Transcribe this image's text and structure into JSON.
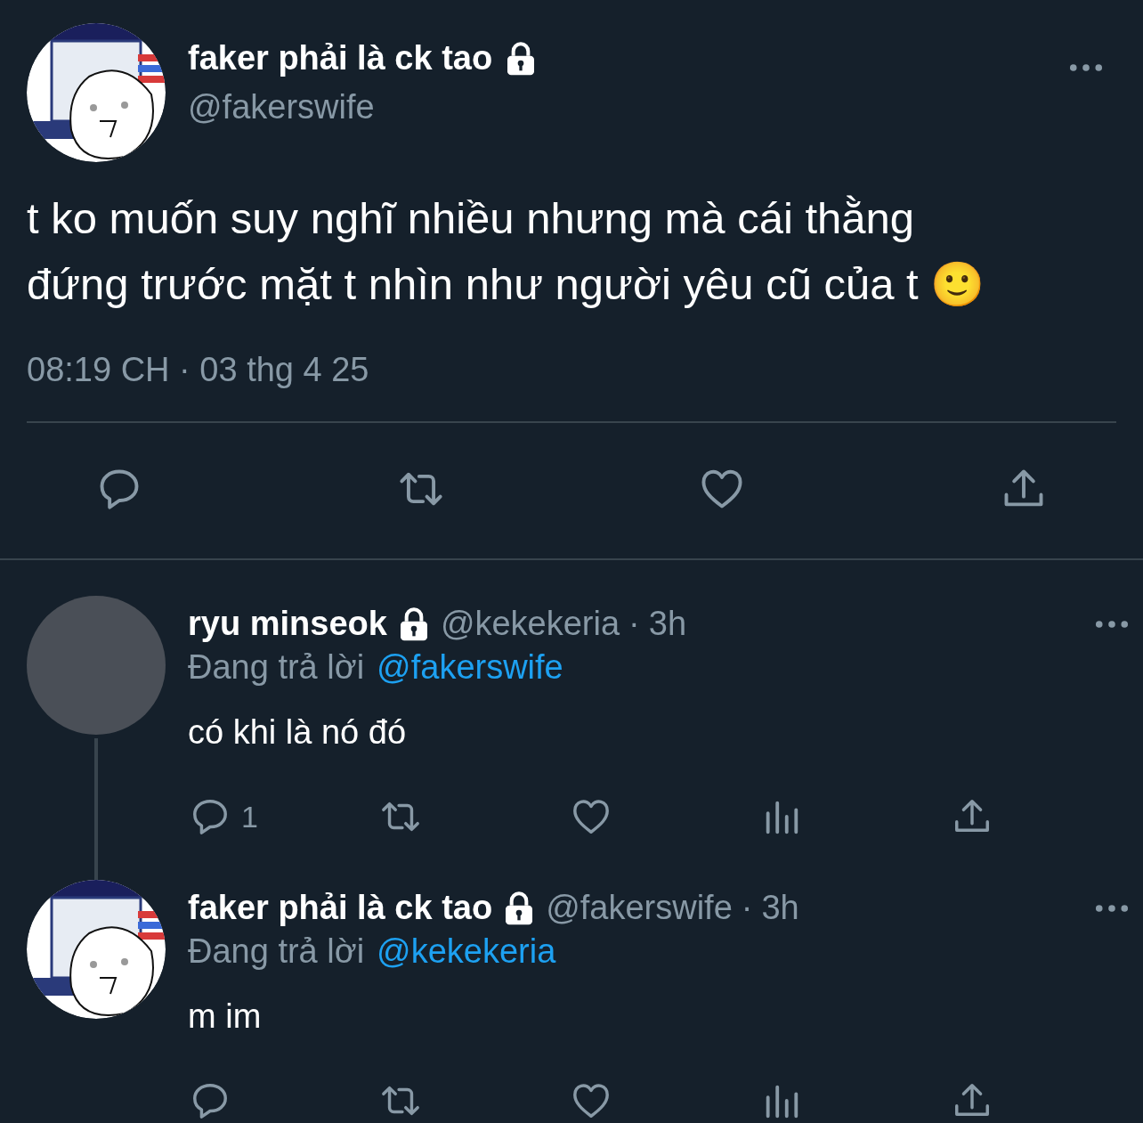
{
  "main_tweet": {
    "avatar": {
      "kind": "cartoon"
    },
    "name": "faker phải là ck tao",
    "locked": true,
    "handle": "@fakerswife",
    "text": "t ko muốn suy nghĩ nhiều nhưng mà cái thằng đứng trước mặt t nhìn như người yêu cũ của t 🙂",
    "timestamp": "08:19 CH · 03 thg 4 25"
  },
  "replies": [
    {
      "avatar": {
        "kind": "photo"
      },
      "name": "ryu minseok",
      "locked": true,
      "handle": "@kekekeria",
      "separator": "·",
      "time": "3h",
      "replying_label": "Đang trả lời",
      "replying_to": "@fakerswife",
      "text": "có khi là nó đó",
      "reply_count": "1"
    },
    {
      "avatar": {
        "kind": "cartoon"
      },
      "name": "faker phải là ck tao",
      "locked": true,
      "handle": "@fakerswife",
      "separator": "·",
      "time": "3h",
      "replying_label": "Đang trả lời",
      "replying_to": "@kekekeria",
      "text": "m im"
    }
  ]
}
